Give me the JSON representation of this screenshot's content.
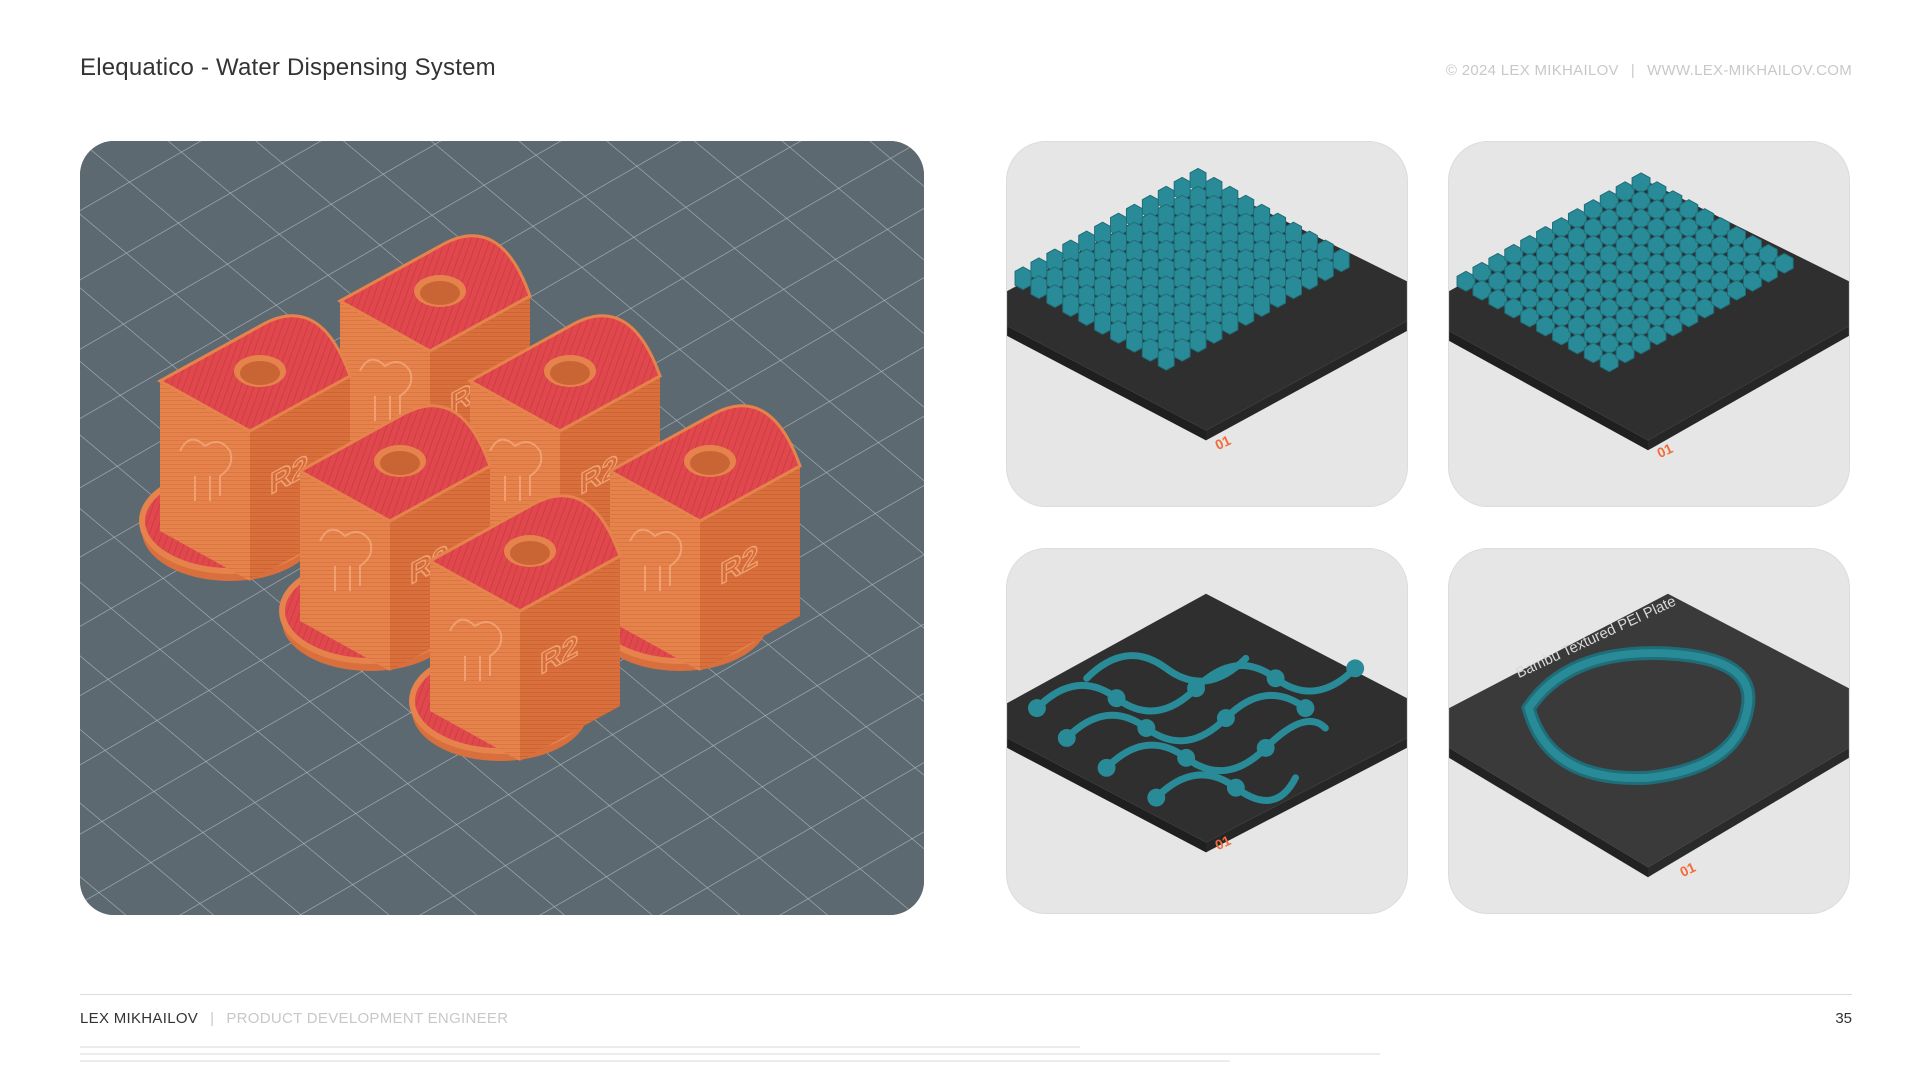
{
  "header": {
    "title": "Elequatico - Water Dispensing System",
    "copyright": "© 2024 LEX MIKHAILOV",
    "website": "WWW.LEX-MIKHAILOV.COM"
  },
  "images": {
    "main": {
      "label": "six-printed-parts-render"
    },
    "thumbnails": [
      {
        "name": "plate-grid-parts",
        "plate_number": "01"
      },
      {
        "name": "plate-clip-parts",
        "plate_number": "01"
      },
      {
        "name": "plate-linked-parts",
        "plate_number": "01"
      },
      {
        "name": "plate-ring-part",
        "plate_number": "01",
        "plate_text": "Bambu Textured PEI Plate"
      }
    ]
  },
  "footer": {
    "name": "LEX MIKHAILOV",
    "role": "PRODUCT DEVELOPMENT ENGINEER",
    "page_number": "35"
  },
  "colors": {
    "part_orange": "#e6824c",
    "part_red": "#e0484d",
    "bed_gray": "#5d6971",
    "print_teal": "#2a8b98",
    "plate_dark": "#3a3a3a",
    "plate_accent": "#f26b3a"
  }
}
